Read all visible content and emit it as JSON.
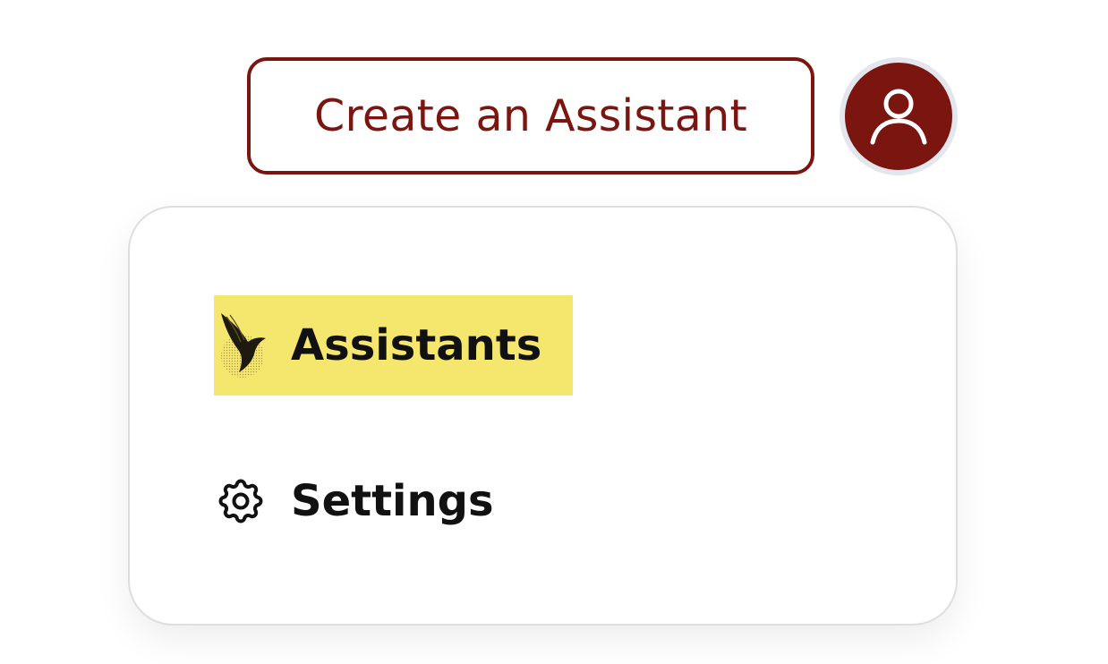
{
  "header": {
    "create_button_label": "Create an Assistant"
  },
  "menu": {
    "items": [
      {
        "label": "Assistants",
        "icon": "assistants-bird-logo-icon",
        "highlighted": true
      },
      {
        "label": "Settings",
        "icon": "gear-icon",
        "highlighted": false
      }
    ]
  },
  "colors": {
    "brand": "#7a1510",
    "highlight": "#f5e66e",
    "avatar_ring": "#e4e6ee",
    "menu_border": "#dedede"
  }
}
